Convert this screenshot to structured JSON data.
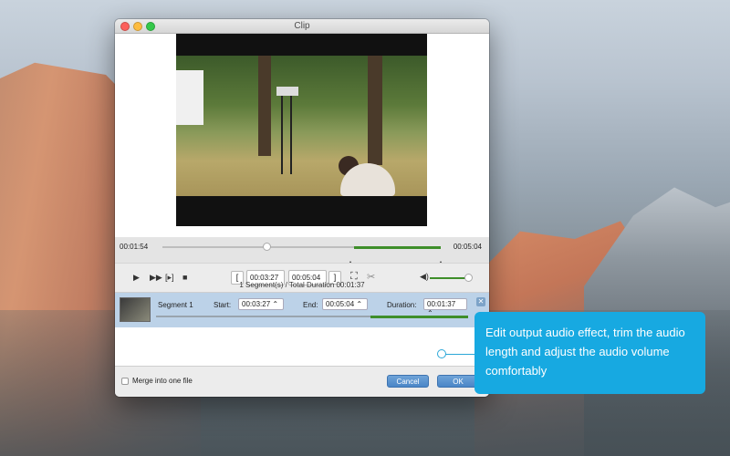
{
  "window": {
    "title": "Clip"
  },
  "timeline": {
    "current_time": "00:01:54",
    "end_time": "00:05:04",
    "playhead_progress": 0.37,
    "selection_start": 0.69,
    "selection_end": 1.0
  },
  "controls": {
    "start_time": "00:03:27",
    "end_time": "00:05:04",
    "play_icon": "play-icon",
    "next_frame_icon": "next-frame-icon",
    "jump_icon": "jump-to-segment-icon",
    "stop_icon": "stop-icon",
    "set_start_icon": "bracket-start-icon",
    "set_end_icon": "bracket-end-icon",
    "crop_icon": "crop-icon",
    "cut_icon": "scissors-icon",
    "volume_icon": "speaker-icon",
    "volume_level": 1.0
  },
  "summary": "1 Segment(s) / Total Duration 00:01:37",
  "segments": [
    {
      "name": "Segment 1",
      "start_label": "Start:",
      "start": "00:03:27",
      "end_label": "End:",
      "end": "00:05:04",
      "duration_label": "Duration:",
      "duration": "00:01:37"
    }
  ],
  "footer": {
    "merge_label": "Merge into one file",
    "merge_checked": false,
    "cancel_label": "Cancel",
    "ok_label": "OK"
  },
  "callout": {
    "text": "Edit output audio effect, trim the audio length and adjust the audio volume comfortably"
  },
  "colors": {
    "accent": "#3e8e2a",
    "callout": "#17a9e1",
    "selection_row": "#bcd2e8"
  }
}
